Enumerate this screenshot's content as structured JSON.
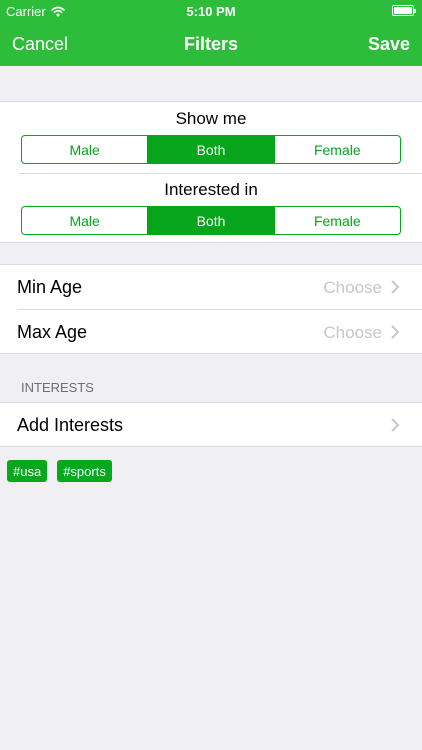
{
  "status_bar": {
    "carrier": "Carrier",
    "time": "5:10 PM",
    "battery_fraction": 1.0
  },
  "nav": {
    "left_label": "Cancel",
    "title": "Filters",
    "right_label": "Save"
  },
  "show_me": {
    "label": "Show me",
    "options": [
      "Male",
      "Both",
      "Female"
    ],
    "selected": "Both"
  },
  "interested_in": {
    "label": "Interested in",
    "options": [
      "Male",
      "Both",
      "Female"
    ],
    "selected": "Both"
  },
  "age": {
    "min": {
      "label": "Min Age",
      "value": "Choose"
    },
    "max": {
      "label": "Max Age",
      "value": "Choose"
    }
  },
  "interests": {
    "header": "INTERESTS",
    "add_label": "Add Interests",
    "tags": [
      "#usa",
      "#sports"
    ]
  },
  "colors": {
    "accent": "#2dbd3a",
    "segment_green": "#07a51b",
    "placeholder": "#c7c7cc"
  }
}
